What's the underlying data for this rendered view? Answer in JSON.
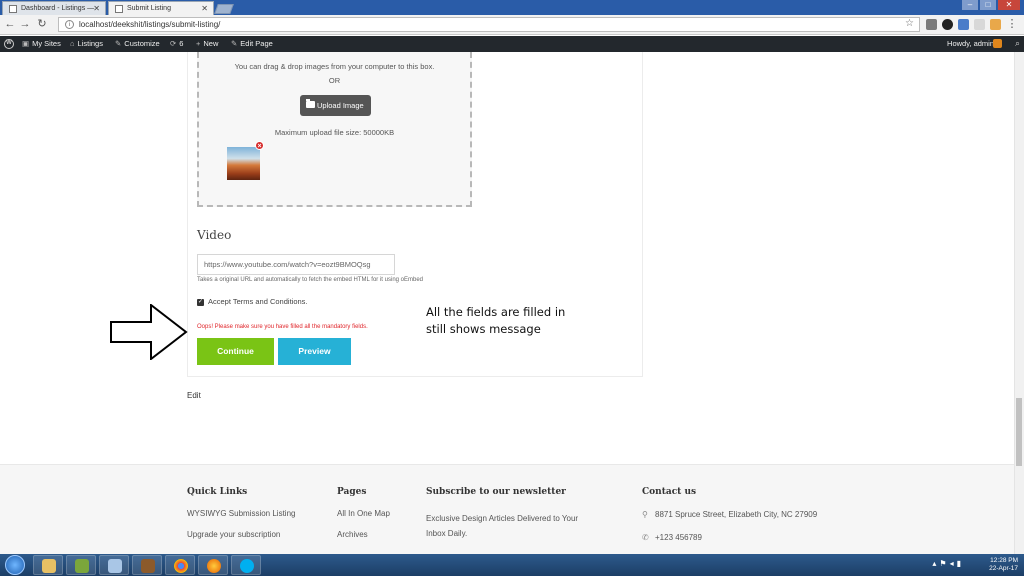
{
  "browser": {
    "tabs": [
      {
        "title": "Dashboard - Listings —"
      },
      {
        "title": "Submit Listing"
      }
    ],
    "url": "localhost/deekshit/listings/submit-listing/"
  },
  "adminbar": {
    "my_sites": "My Sites",
    "listings": "Listings",
    "customize": "Customize",
    "updates_count": "6",
    "new": "New",
    "edit_page": "Edit Page",
    "howdy": "Howdy, admin"
  },
  "upload": {
    "drag_text": "You can drag & drop images from your computer to this box.",
    "or_text": "OR",
    "button_label": "Upload Image",
    "max_size_text": "Maximum upload file size: 50000KB"
  },
  "video": {
    "heading": "Video",
    "input_value": "https://www.youtube.com/watch?v=eozt9BMOQsg",
    "hint": "Takes a original URL and automatically to fetch the embed HTML for it using oEmbed"
  },
  "terms_label": "Accept Terms and Conditions.",
  "error_message": "Oops! Please make sure you have filled all the mandatory fields.",
  "buttons": {
    "continue": "Continue",
    "preview": "Preview"
  },
  "annotation": {
    "line1": "All the fields are filled in",
    "line2": "still shows message"
  },
  "edit_link": "Edit",
  "footer": {
    "quick_links": {
      "heading": "Quick Links",
      "items": [
        "WYSIWYG Submission Listing",
        "Upgrade your subscription"
      ]
    },
    "pages": {
      "heading": "Pages",
      "items": [
        "All In One Map",
        "Archives"
      ]
    },
    "newsletter": {
      "heading": "Subscribe to our newsletter",
      "text_line1": "Exclusive Design Articles Delivered to Your",
      "text_line2": "Inbox Daily."
    },
    "contact": {
      "heading": "Contact us",
      "address": "8871 Spruce Street, Elizabeth City, NC 27909",
      "phone": "+123 456789"
    }
  },
  "taskbar": {
    "time": "12:28 PM",
    "date": "22-Apr-17"
  },
  "colors": {
    "continue": "#7ac415",
    "preview": "#26b1d6",
    "error": "#e0262b",
    "adminbar": "#23282d"
  }
}
